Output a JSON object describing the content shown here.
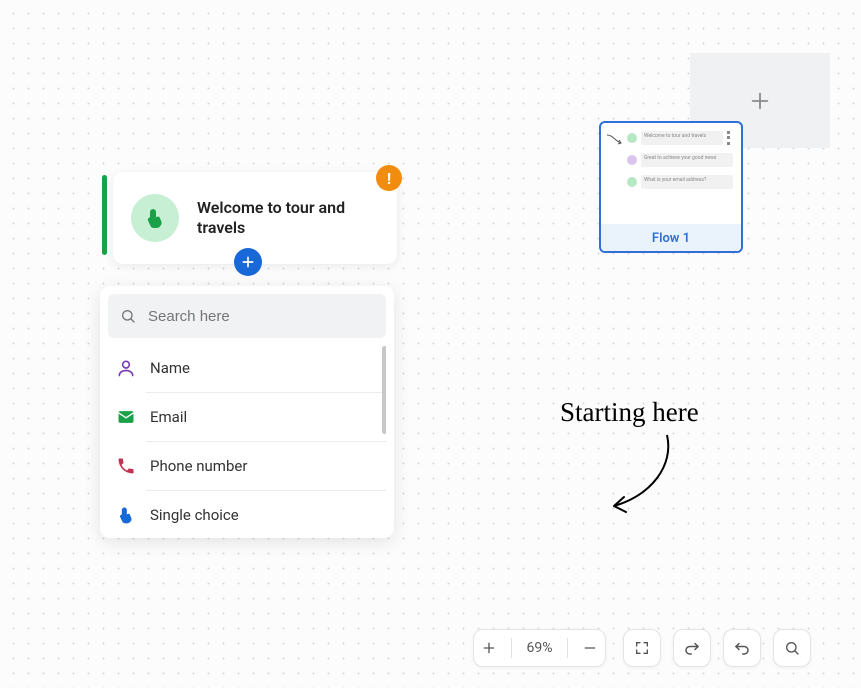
{
  "flow_card": {
    "title": "Flow 1"
  },
  "welcome": {
    "title": "Welcome to tour and travels"
  },
  "options": {
    "search_placeholder": "Search here",
    "items": {
      "0": {
        "label": "Name"
      },
      "1": {
        "label": "Email"
      },
      "2": {
        "label": "Phone number"
      },
      "3": {
        "label": "Single choice"
      }
    }
  },
  "annotation": {
    "text": "Starting here"
  },
  "toolbar": {
    "zoom": "69%"
  }
}
